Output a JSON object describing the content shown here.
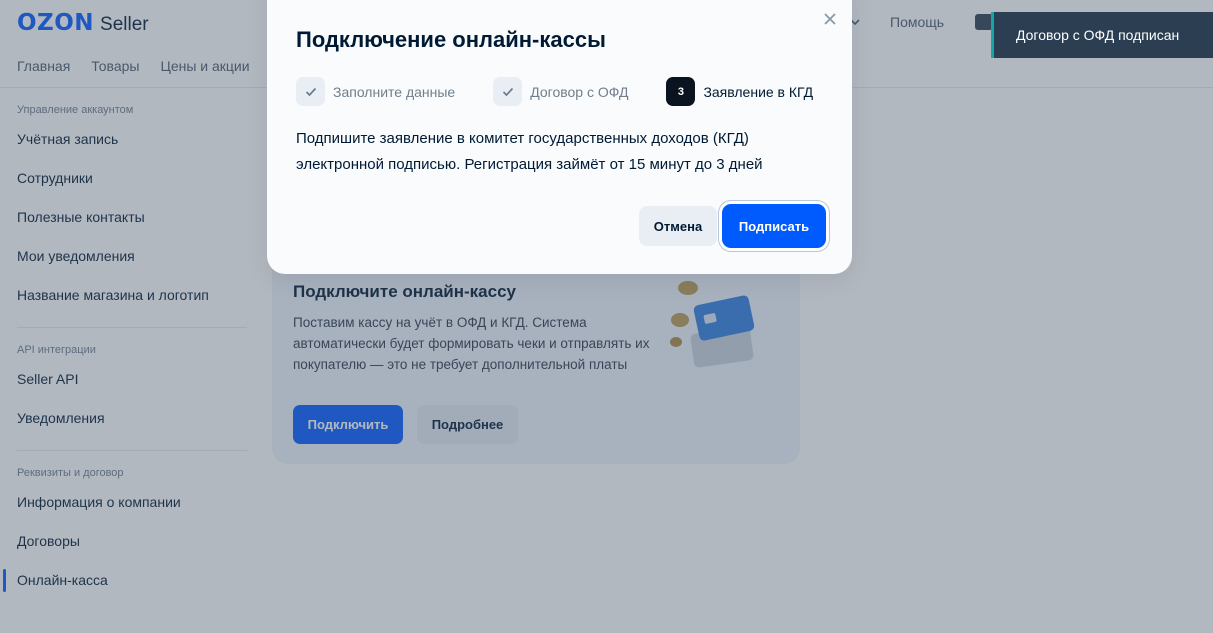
{
  "header": {
    "logo_brand": "OZON",
    "logo_product": "Seller",
    "nav": [
      "Главная",
      "Товары",
      "Цены и акции"
    ],
    "help_label": "Помощь"
  },
  "sidebar": {
    "sections": [
      {
        "title": "Управление аккаунтом",
        "items": [
          "Учётная запись",
          "Сотрудники",
          "Полезные контакты",
          "Мои уведомления",
          "Название магазина и логотип"
        ]
      },
      {
        "title": "API интеграции",
        "items": [
          "Seller API",
          "Уведомления"
        ]
      },
      {
        "title": "Реквизиты и договор",
        "items": [
          "Информация о компании",
          "Договоры",
          "Онлайн-касса"
        ]
      }
    ],
    "active_item": "Онлайн-касса"
  },
  "card": {
    "title": "Подключите онлайн-кассу",
    "text": "Поставим кассу на учёт в ОФД и КГД. Система автоматически будет формировать чеки и отправлять их покупателю — это не требует дополнительной платы",
    "primary_button": "Подключить",
    "secondary_button": "Подробнее"
  },
  "toast": {
    "text": "Договор с ОФД подписан"
  },
  "modal": {
    "title": "Подключение онлайн-кассы",
    "steps": [
      {
        "label": "Заполните данные",
        "state": "done"
      },
      {
        "label": "Договор с ОФД",
        "state": "done"
      },
      {
        "label": "Заявление в КГД",
        "state": "current",
        "number": "3"
      }
    ],
    "text": "Подпишите заявление в комитет государственных доходов (КГД) электронной подписью. Регистрация займёт от 15 минут до 3 дней",
    "cancel_label": "Отмена",
    "sign_label": "Подписать"
  },
  "colors": {
    "accent": "#005bff",
    "text": "#001a34",
    "toast_bg": "#2c3e52"
  }
}
